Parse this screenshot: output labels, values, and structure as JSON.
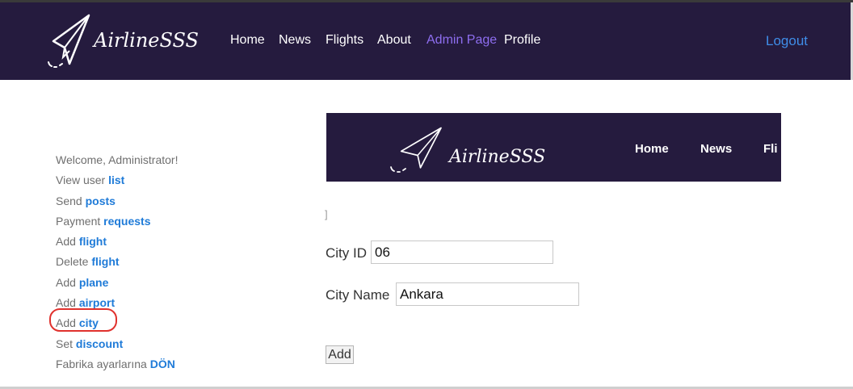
{
  "header": {
    "brand": "AirlineSSS",
    "nav": [
      "Home",
      "News",
      "Flights",
      "About",
      "Admin Page",
      "Profile"
    ],
    "active": "Admin Page",
    "logout": "Logout"
  },
  "sidebar": {
    "rows": [
      {
        "text": "Welcome, Administrator!",
        "link": ""
      },
      {
        "text": "View user ",
        "link": "list"
      },
      {
        "text": "Send ",
        "link": "posts"
      },
      {
        "text": "Payment ",
        "link": "requests"
      },
      {
        "text": "Add ",
        "link": "flight"
      },
      {
        "text": "Delete ",
        "link": "flight"
      },
      {
        "text": "Add ",
        "link": "plane"
      },
      {
        "text": "Add ",
        "link": "airport"
      },
      {
        "text": "Add ",
        "link": "city"
      },
      {
        "text": "Set ",
        "link": "discount"
      },
      {
        "text": "Fabrika ayarlarına ",
        "link": "DÖN"
      }
    ]
  },
  "panel": {
    "brand": "AirlineSSS",
    "nav": [
      "Home",
      "News",
      "Fli"
    ],
    "fragment": "]",
    "city_id_label": "City ID",
    "city_id_value": "06",
    "city_name_label": "City Name",
    "city_name_value": "Ankara",
    "add_label": "Add"
  },
  "colors": {
    "navbar_bg": "#251b3e",
    "active_nav": "#8e6ef0",
    "link": "#1f7bd8",
    "logout": "#3f8de8",
    "highlight": "#e0312d"
  }
}
